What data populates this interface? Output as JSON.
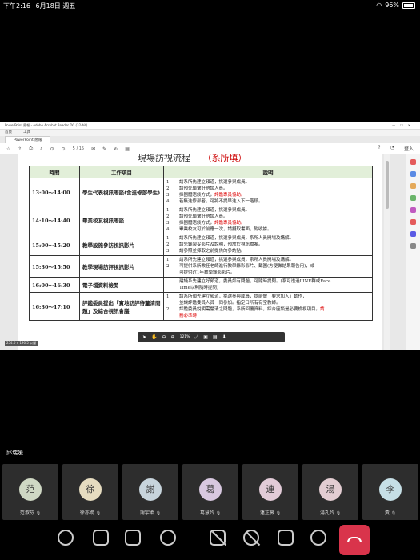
{
  "status": {
    "time": "下午2:16",
    "date": "6月18日 週五",
    "battery": "96%"
  },
  "screen": {
    "window_title": "PowerPoint 簡報 - Adobe Acrobat Reader DC (32-bit)",
    "menu": [
      "首頁",
      "工具"
    ],
    "tab": "PowerPoint 簡報",
    "page_indicator": "5 / 15",
    "signin": "登入",
    "heading": "現場訪視流程",
    "heading_red": "（系所填）",
    "table_headers": [
      "時間",
      "工作項目",
      "說明"
    ],
    "rows": [
      {
        "time": "13:00～14:00",
        "item": "學生代表視訊晤談(含進修部學生)",
        "desc": [
          {
            "n": "1.",
            "text": "請系所先建立頻道，挑選參與成員。"
          },
          {
            "n": "2.",
            "text": "請預先聯繫好晤談人員。"
          },
          {
            "n": "3.",
            "text": "採團體晤談方式，",
            "red": "評鑑專員協助。"
          },
          {
            "n": "4.",
            "text": "若無進修部者，可將不提早進入下一階段。"
          }
        ]
      },
      {
        "time": "14:10～14:40",
        "item": "畢業校友視訊晤談",
        "desc": [
          {
            "n": "1.",
            "text": "請系所先建立頻道，挑選參與成員。"
          },
          {
            "n": "2.",
            "text": "請預先聯繫好晤談人員。"
          },
          {
            "n": "3.",
            "text": "採團體晤談方式，",
            "red": "評鑑專員協助。"
          },
          {
            "n": "4.",
            "text": "畢業校友可於前應一次，請擬取書面，附收據。"
          }
        ]
      },
      {
        "time": "15:00～15:20",
        "item": "教學設施參訪視訊影片",
        "desc": [
          {
            "n": "1.",
            "text": "請系所先建立頻道，挑選參與成員，系所人員開場及講解。"
          },
          {
            "n": "2.",
            "text": "請先錄製妥影片及說明，預放於視訊檔案。"
          },
          {
            "n": "3.",
            "text": "請參照並擇取之前提供的參訪點。"
          }
        ]
      },
      {
        "time": "15:30～15:50",
        "item": "教學現場訪評視訊影片",
        "desc": [
          {
            "n": "1.",
            "text": "請系所先建立頻道，挑選參與成員，系所人員開場及講解。"
          },
          {
            "n": "2.",
            "text": "可提供系所教任老師進行教學錄影影片、截圖(方便做結果報告用)，或"
          },
          {
            "n": "",
            "text": "可提供近1年教學錄影影片。"
          }
        ]
      },
      {
        "time": "16:00～16:30",
        "item": "電子檔資料檢閱",
        "desc": [
          {
            "n": "",
            "text": "建議系先建立好頻道，委員如有問題，可隨時提問。(系可透過LINE群或Face"
          },
          {
            "n": "",
            "text": "Time以利隨時提問)"
          }
        ]
      },
      {
        "time": "16:30～17:10",
        "item": "評鑑委員提出「實地訪評待釐清問題」及綜合視訊會議",
        "desc": [
          {
            "n": "1.",
            "text": "請系所預先建立頻道，挑選參與成員，提前做「要求加入」動作，"
          },
          {
            "n": "",
            "text": "並讓評鑑委員人員一同參加。指定日所有有空教師。"
          },
          {
            "n": "2.",
            "text": "評鑑委員說明需釐清之問題，系所回覆資料，綜合座談是必要檢視項目。",
            "red": "請"
          },
          {
            "n": "",
            "text": "",
            "red": "務必準時"
          }
        ]
      }
    ],
    "zoom": "121%",
    "resolution_badge": "254.0 x 190.5 公釐"
  },
  "speaker_name": "邱瑞媛",
  "participants": [
    {
      "initial": "范",
      "name": "范淑芬",
      "color": "#cfd8c4"
    },
    {
      "initial": "徐",
      "name": "徐亦嫺",
      "color": "#e6dcc0"
    },
    {
      "initial": "謝",
      "name": "謝宇柔",
      "color": "#c7d4dc"
    },
    {
      "initial": "葛",
      "name": "葛慧玲",
      "color": "#d8c8e0"
    },
    {
      "initial": "連",
      "name": "連芷薇",
      "color": "#e2cbd8"
    },
    {
      "initial": "湯",
      "name": "湯孔玲",
      "color": "#e3cdd2"
    },
    {
      "initial": "李",
      "name": "黃",
      "color": "#c6dfe6"
    }
  ]
}
